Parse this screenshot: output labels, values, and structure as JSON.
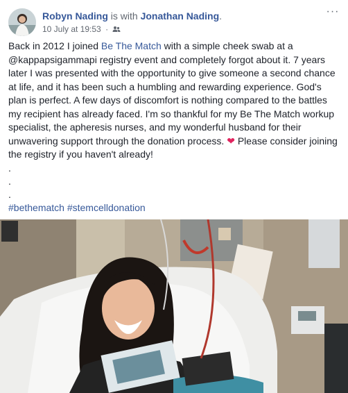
{
  "post": {
    "author": "Robyn Nading",
    "with_text": "is with",
    "tagged": "Jonathan Nading",
    "period": ".",
    "timestamp": "10 July at 19:53",
    "dot": "·",
    "audience_icon": "friends-icon",
    "more_options": "···",
    "body": {
      "p1_before_link": "Back in 2012 I joined ",
      "link_text": "Be The Match",
      "p1_after_link": " with a simple cheek swab at a @kappapsigammapi registry event and completely forgot about it. 7 years later I was presented with the opportunity to give someone a second chance at life, and it has been such a humbling and rewarding experience. God's plan is perfect. A few days of discomfort is nothing compared to the battles my recipient has already faced. I'm so thankful for my Be The Match workup specialist, the apheresis nurses, and my wonderful husband for their unwavering support through the donation process. ",
      "heart": "❤",
      "p1_end": " Please consider joining the registry if you haven't already!",
      "dot1": ".",
      "dot2": ".",
      "dot3": ".",
      "hashtag1": "#bethematch",
      "hashtag2": "#stemcelldonation"
    },
    "colors": {
      "link": "#365899",
      "meta": "#616770",
      "text": "#1d2129",
      "heart": "#e0245e"
    }
  }
}
